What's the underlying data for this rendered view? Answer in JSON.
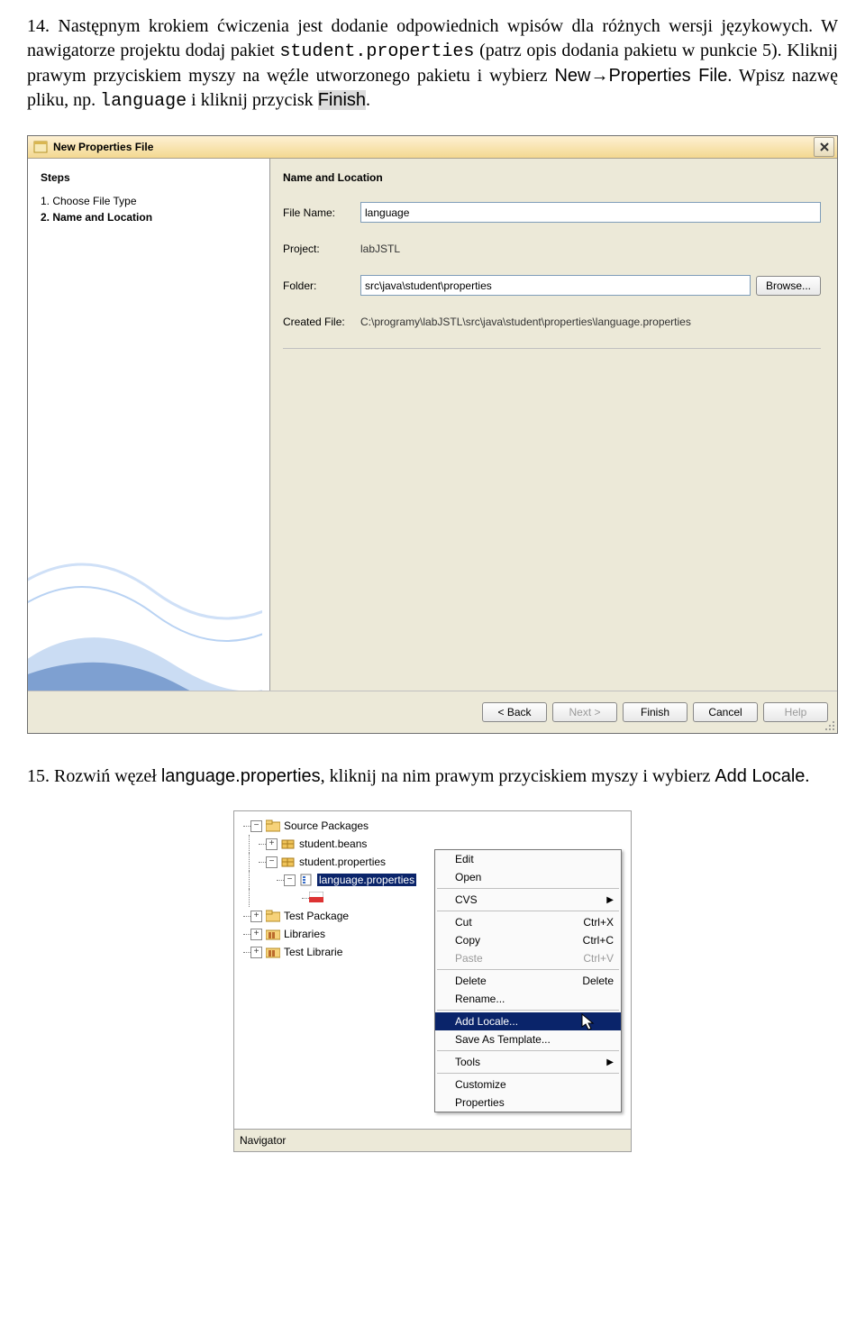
{
  "para14": {
    "num": "14. ",
    "t1": "Następnym krokiem ćwiczenia jest dodanie odpowiednich wpisów dla różnych wersji językowych. W nawigatorze projektu dodaj pakiet ",
    "code1": "student.properties",
    "t2": " (patrz opis dodania pakietu w punkcie 5). Kliknij prawym przyciskiem myszy na węźle utworzonego pakietu i wybierz ",
    "menu1": "New→Properties File",
    "t3": ". Wpisz nazwę pliku, np. ",
    "code2": "language",
    "t4": " i kliknij przycisk ",
    "btn": "Finish",
    "t5": "."
  },
  "dlg": {
    "title": "New Properties File",
    "stepsHeading": "Steps",
    "step1": "1.    Choose File Type",
    "step2": "2.    Name and Location",
    "formHeading": "Name and Location",
    "fileNameLabel": "File Name:",
    "fileNameValue": "language",
    "projectLabel": "Project:",
    "projectValue": "labJSTL",
    "folderLabel": "Folder:",
    "folderValue": "src\\java\\student\\properties",
    "browseBtn": "Browse...",
    "createdLabel": "Created File:",
    "createdValue": "C:\\programy\\labJSTL\\src\\java\\student\\properties\\language.properties",
    "back": "< Back",
    "next": "Next >",
    "finish": "Finish",
    "cancel": "Cancel",
    "help": "Help"
  },
  "para15": {
    "num": "15. ",
    "t1": "Rozwiń węzeł ",
    "file": "language.properties",
    "t2": ", kliknij na nim prawym przyciskiem myszy i wybierz ",
    "menu": "Add Locale",
    "t3": "."
  },
  "tree": {
    "srcPkg": "Source Packages",
    "beans": "student.beans",
    "props": "student.properties",
    "lang": "language.properties",
    "testPkg": "Test Package",
    "libs": "Libraries",
    "testLibs": "Test Librarie"
  },
  "menu": {
    "edit": "Edit",
    "open": "Open",
    "cvs": "CVS",
    "cut": "Cut",
    "cutSc": "Ctrl+X",
    "copy": "Copy",
    "copySc": "Ctrl+C",
    "paste": "Paste",
    "pasteSc": "Ctrl+V",
    "delete": "Delete",
    "deleteSc": "Delete",
    "rename": "Rename...",
    "addLocale": "Add Locale...",
    "saveTpl": "Save As Template...",
    "tools": "Tools",
    "customize": "Customize",
    "properties": "Properties"
  },
  "nav": "Navigator"
}
